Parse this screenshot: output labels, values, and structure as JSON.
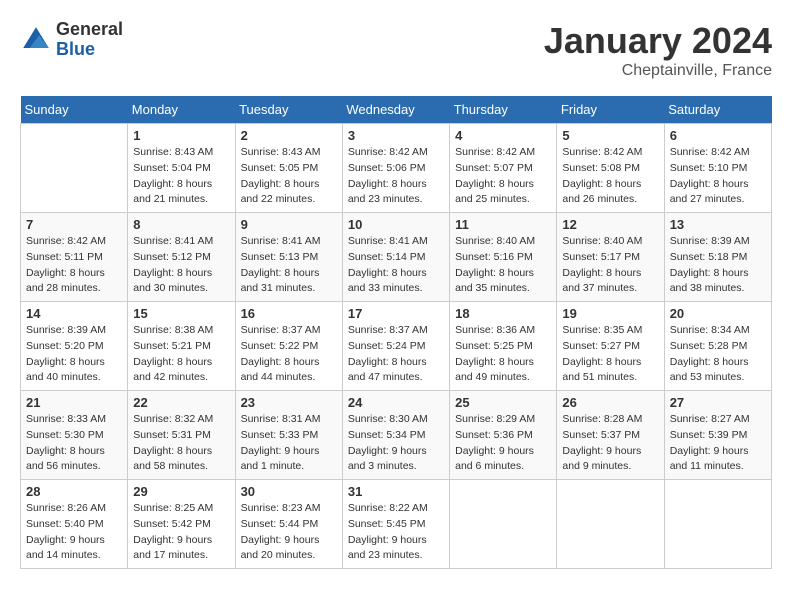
{
  "header": {
    "logo_line1": "General",
    "logo_line2": "Blue",
    "title": "January 2024",
    "subtitle": "Cheptainville, France"
  },
  "weekdays": [
    "Sunday",
    "Monday",
    "Tuesday",
    "Wednesday",
    "Thursday",
    "Friday",
    "Saturday"
  ],
  "weeks": [
    [
      {
        "day": "",
        "sunrise": "",
        "sunset": "",
        "daylight": ""
      },
      {
        "day": "1",
        "sunrise": "Sunrise: 8:43 AM",
        "sunset": "Sunset: 5:04 PM",
        "daylight": "Daylight: 8 hours and 21 minutes."
      },
      {
        "day": "2",
        "sunrise": "Sunrise: 8:43 AM",
        "sunset": "Sunset: 5:05 PM",
        "daylight": "Daylight: 8 hours and 22 minutes."
      },
      {
        "day": "3",
        "sunrise": "Sunrise: 8:42 AM",
        "sunset": "Sunset: 5:06 PM",
        "daylight": "Daylight: 8 hours and 23 minutes."
      },
      {
        "day": "4",
        "sunrise": "Sunrise: 8:42 AM",
        "sunset": "Sunset: 5:07 PM",
        "daylight": "Daylight: 8 hours and 25 minutes."
      },
      {
        "day": "5",
        "sunrise": "Sunrise: 8:42 AM",
        "sunset": "Sunset: 5:08 PM",
        "daylight": "Daylight: 8 hours and 26 minutes."
      },
      {
        "day": "6",
        "sunrise": "Sunrise: 8:42 AM",
        "sunset": "Sunset: 5:10 PM",
        "daylight": "Daylight: 8 hours and 27 minutes."
      }
    ],
    [
      {
        "day": "7",
        "sunrise": "Sunrise: 8:42 AM",
        "sunset": "Sunset: 5:11 PM",
        "daylight": "Daylight: 8 hours and 28 minutes."
      },
      {
        "day": "8",
        "sunrise": "Sunrise: 8:41 AM",
        "sunset": "Sunset: 5:12 PM",
        "daylight": "Daylight: 8 hours and 30 minutes."
      },
      {
        "day": "9",
        "sunrise": "Sunrise: 8:41 AM",
        "sunset": "Sunset: 5:13 PM",
        "daylight": "Daylight: 8 hours and 31 minutes."
      },
      {
        "day": "10",
        "sunrise": "Sunrise: 8:41 AM",
        "sunset": "Sunset: 5:14 PM",
        "daylight": "Daylight: 8 hours and 33 minutes."
      },
      {
        "day": "11",
        "sunrise": "Sunrise: 8:40 AM",
        "sunset": "Sunset: 5:16 PM",
        "daylight": "Daylight: 8 hours and 35 minutes."
      },
      {
        "day": "12",
        "sunrise": "Sunrise: 8:40 AM",
        "sunset": "Sunset: 5:17 PM",
        "daylight": "Daylight: 8 hours and 37 minutes."
      },
      {
        "day": "13",
        "sunrise": "Sunrise: 8:39 AM",
        "sunset": "Sunset: 5:18 PM",
        "daylight": "Daylight: 8 hours and 38 minutes."
      }
    ],
    [
      {
        "day": "14",
        "sunrise": "Sunrise: 8:39 AM",
        "sunset": "Sunset: 5:20 PM",
        "daylight": "Daylight: 8 hours and 40 minutes."
      },
      {
        "day": "15",
        "sunrise": "Sunrise: 8:38 AM",
        "sunset": "Sunset: 5:21 PM",
        "daylight": "Daylight: 8 hours and 42 minutes."
      },
      {
        "day": "16",
        "sunrise": "Sunrise: 8:37 AM",
        "sunset": "Sunset: 5:22 PM",
        "daylight": "Daylight: 8 hours and 44 minutes."
      },
      {
        "day": "17",
        "sunrise": "Sunrise: 8:37 AM",
        "sunset": "Sunset: 5:24 PM",
        "daylight": "Daylight: 8 hours and 47 minutes."
      },
      {
        "day": "18",
        "sunrise": "Sunrise: 8:36 AM",
        "sunset": "Sunset: 5:25 PM",
        "daylight": "Daylight: 8 hours and 49 minutes."
      },
      {
        "day": "19",
        "sunrise": "Sunrise: 8:35 AM",
        "sunset": "Sunset: 5:27 PM",
        "daylight": "Daylight: 8 hours and 51 minutes."
      },
      {
        "day": "20",
        "sunrise": "Sunrise: 8:34 AM",
        "sunset": "Sunset: 5:28 PM",
        "daylight": "Daylight: 8 hours and 53 minutes."
      }
    ],
    [
      {
        "day": "21",
        "sunrise": "Sunrise: 8:33 AM",
        "sunset": "Sunset: 5:30 PM",
        "daylight": "Daylight: 8 hours and 56 minutes."
      },
      {
        "day": "22",
        "sunrise": "Sunrise: 8:32 AM",
        "sunset": "Sunset: 5:31 PM",
        "daylight": "Daylight: 8 hours and 58 minutes."
      },
      {
        "day": "23",
        "sunrise": "Sunrise: 8:31 AM",
        "sunset": "Sunset: 5:33 PM",
        "daylight": "Daylight: 9 hours and 1 minute."
      },
      {
        "day": "24",
        "sunrise": "Sunrise: 8:30 AM",
        "sunset": "Sunset: 5:34 PM",
        "daylight": "Daylight: 9 hours and 3 minutes."
      },
      {
        "day": "25",
        "sunrise": "Sunrise: 8:29 AM",
        "sunset": "Sunset: 5:36 PM",
        "daylight": "Daylight: 9 hours and 6 minutes."
      },
      {
        "day": "26",
        "sunrise": "Sunrise: 8:28 AM",
        "sunset": "Sunset: 5:37 PM",
        "daylight": "Daylight: 9 hours and 9 minutes."
      },
      {
        "day": "27",
        "sunrise": "Sunrise: 8:27 AM",
        "sunset": "Sunset: 5:39 PM",
        "daylight": "Daylight: 9 hours and 11 minutes."
      }
    ],
    [
      {
        "day": "28",
        "sunrise": "Sunrise: 8:26 AM",
        "sunset": "Sunset: 5:40 PM",
        "daylight": "Daylight: 9 hours and 14 minutes."
      },
      {
        "day": "29",
        "sunrise": "Sunrise: 8:25 AM",
        "sunset": "Sunset: 5:42 PM",
        "daylight": "Daylight: 9 hours and 17 minutes."
      },
      {
        "day": "30",
        "sunrise": "Sunrise: 8:23 AM",
        "sunset": "Sunset: 5:44 PM",
        "daylight": "Daylight: 9 hours and 20 minutes."
      },
      {
        "day": "31",
        "sunrise": "Sunrise: 8:22 AM",
        "sunset": "Sunset: 5:45 PM",
        "daylight": "Daylight: 9 hours and 23 minutes."
      },
      {
        "day": "",
        "sunrise": "",
        "sunset": "",
        "daylight": ""
      },
      {
        "day": "",
        "sunrise": "",
        "sunset": "",
        "daylight": ""
      },
      {
        "day": "",
        "sunrise": "",
        "sunset": "",
        "daylight": ""
      }
    ]
  ]
}
